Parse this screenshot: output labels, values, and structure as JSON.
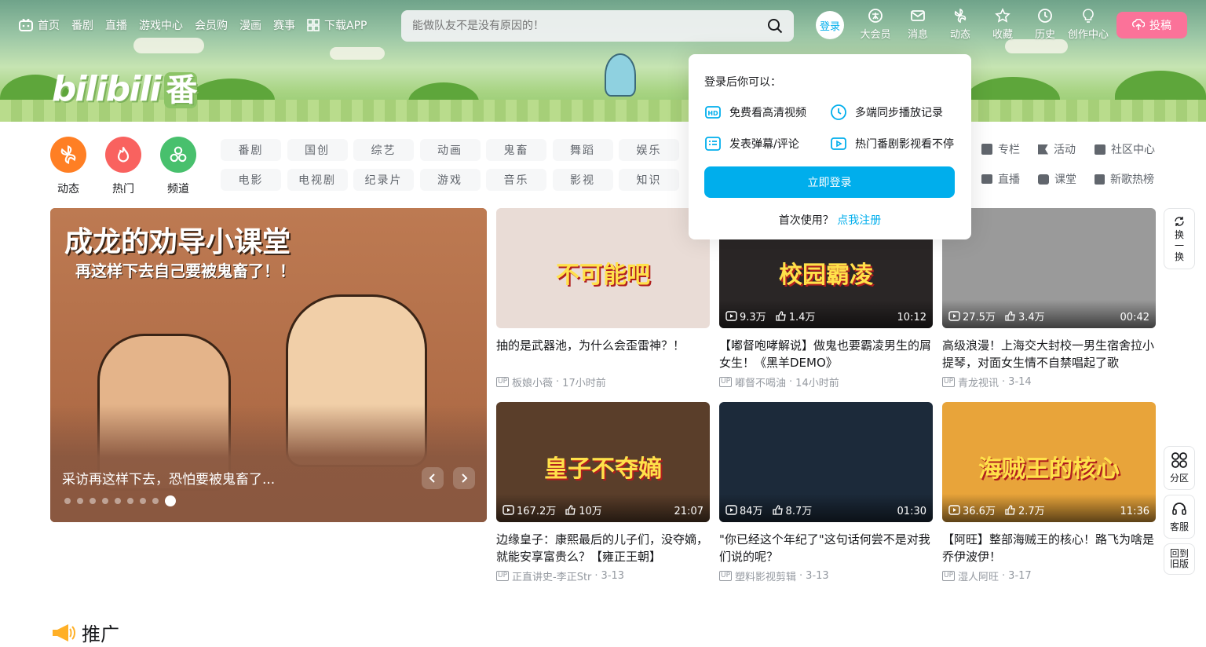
{
  "nav": {
    "left": [
      "首页",
      "番剧",
      "直播",
      "游戏中心",
      "会员购",
      "漫画",
      "赛事"
    ],
    "download": "下载APP",
    "search_placeholder": "能做队友不是没有原因的！",
    "login": "登录",
    "right": [
      "大会员",
      "消息",
      "动态",
      "收藏",
      "历史",
      "创作中心"
    ],
    "upload": "投稿"
  },
  "logo": {
    "text": "bilibili",
    "badge": "番"
  },
  "channels": [
    {
      "label": "动态",
      "color": "#ff7f24"
    },
    {
      "label": "热门",
      "color": "#f9625f"
    },
    {
      "label": "频道",
      "color": "#48c06d"
    }
  ],
  "tags": [
    "番剧",
    "国创",
    "综艺",
    "动画",
    "鬼畜",
    "舞蹈",
    "娱乐",
    "电影",
    "电视剧",
    "纪录片",
    "游戏",
    "音乐",
    "影视",
    "知识"
  ],
  "links": [
    "专栏",
    "活动",
    "社区中心",
    "直播",
    "课堂",
    "新歌热榜"
  ],
  "carousel": {
    "art_title": "成龙的劝导小课堂",
    "art_subtitle": "再这样下去自己要被鬼畜了！！",
    "caption": "采访再这样下去，恐怕要被鬼畜了...",
    "dots": 9,
    "active_dot": 9
  },
  "videos": [
    {
      "title": "抽的是武器池，为什么会歪雷神？！",
      "views": "",
      "likes": "",
      "duration": "",
      "author": "板娘小薇",
      "date": "17小时前",
      "overlay": "不可能吧",
      "bg": "#e9dcd6"
    },
    {
      "title": "【嘟督咆哮解说】做鬼也要霸凌男生的屑女生！《黑羊DEMO》",
      "views": "9.3万",
      "likes": "1.4万",
      "duration": "10:12",
      "author": "嘟督不喝油",
      "date": "14小时前",
      "overlay": "校园霸凌",
      "bg": "#2a2626"
    },
    {
      "title": "高级浪漫！上海交大封校一男生宿舍拉小提琴，对面女生情不自禁唱起了歌",
      "views": "27.5万",
      "likes": "3.4万",
      "duration": "00:42",
      "author": "青龙视讯",
      "date": "3-14",
      "overlay": "",
      "bg": "#9a9a9a"
    },
    {
      "title": "边缘皇子：康熙最后的儿子们，没夺嫡，就能安享富贵么？【雍正王朝】",
      "views": "167.2万",
      "likes": "10万",
      "duration": "21:07",
      "author": "正直讲史-李正Str",
      "date": "3-13",
      "overlay": "皇子不夺嫡",
      "bg": "#5a3e2a"
    },
    {
      "title": "\"你已经这个年纪了\"这句话何尝不是对我们说的呢？",
      "views": "84万",
      "likes": "8.7万",
      "duration": "01:30",
      "author": "塑料影视剪辑",
      "date": "3-13",
      "overlay": "",
      "bg": "#1c2a3a"
    },
    {
      "title": "【阿旺】整部海贼王的核心！路飞为啥是乔伊波伊！",
      "views": "36.6万",
      "likes": "2.7万",
      "duration": "11:36",
      "author": "湿人阿旺",
      "date": "3-17",
      "overlay": "海贼王的核心",
      "bg": "#e8a43a"
    }
  ],
  "popup": {
    "title": "登录后你可以：",
    "features": [
      "免费看高清视频",
      "多端同步播放记录",
      "发表弹幕/评论",
      "热门番剧影视看不停"
    ],
    "button": "立即登录",
    "register_prefix": "首次使用？",
    "register_link": "点我注册"
  },
  "side": {
    "refresh": "换一换",
    "zone": "分区",
    "service": "客服",
    "old": "回到旧版"
  },
  "promo": "推广"
}
